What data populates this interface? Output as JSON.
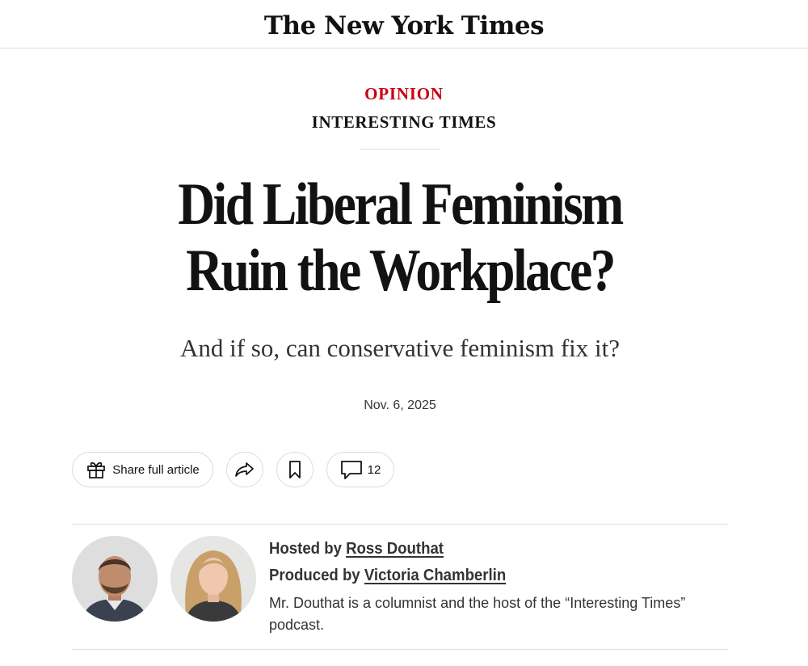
{
  "masthead": {
    "logo_text": "The New York Times"
  },
  "section": {
    "label": "OPINION",
    "color": "#c9000f"
  },
  "column": {
    "name": "INTERESTING TIMES"
  },
  "headline": {
    "line1": "Did Liberal Feminism",
    "line2": "Ruin the Workplace?"
  },
  "dek": "And if so, can conservative feminism fix it?",
  "date": "Nov. 6, 2025",
  "toolbar": {
    "share_label": "Share full article",
    "share_icon": "gift-icon",
    "forward_icon": "share-arrow-icon",
    "save_icon": "bookmark-icon",
    "comments_icon": "comment-icon",
    "comment_count": "12"
  },
  "credits": {
    "host_prefix": "Hosted by",
    "host_name": "Ross Douthat",
    "producer_prefix": "Produced by",
    "producer_name": "Victoria Chamberlin",
    "bio": "Mr. Douthat is a columnist and the host of the “Interesting Times” podcast."
  }
}
